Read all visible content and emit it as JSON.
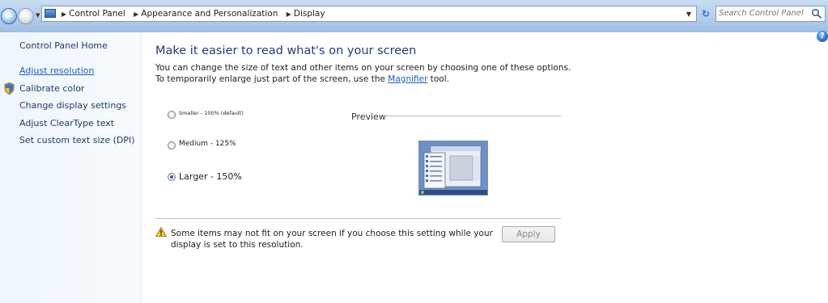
{
  "breadcrumbs": [
    "Control Panel",
    "Appearance and Personalization",
    "Display"
  ],
  "search": {
    "placeholder": "Search Control Panel"
  },
  "sidebar": {
    "home": "Control Panel Home",
    "items": [
      {
        "label": "Adjust resolution",
        "active": true
      },
      {
        "label": "Calibrate color",
        "icon": "shield-icon"
      },
      {
        "label": "Change display settings"
      },
      {
        "label": "Adjust ClearType text"
      },
      {
        "label": "Set custom text size (DPI)"
      }
    ]
  },
  "main": {
    "title": "Make it easier to read what's on your screen",
    "description_before": "You can change the size of text and other items on your screen by choosing one of these options. To temporarily enlarge just part of the screen, use the ",
    "description_link": "Magnifier",
    "description_after": " tool.",
    "options": [
      {
        "label": "Smaller - 100% (default)",
        "selected": false
      },
      {
        "label": "Medium - 125%",
        "selected": false
      },
      {
        "label": "Larger - 150%",
        "selected": true
      }
    ],
    "preview_label": "Preview",
    "warning": "Some items may not fit on your screen if you choose this setting while your display is set to this resolution.",
    "apply_label": "Apply"
  },
  "colors": {
    "link": "#1e5fb4",
    "title": "#1e3f7a",
    "sidebar_bg": "#eef5fd"
  }
}
